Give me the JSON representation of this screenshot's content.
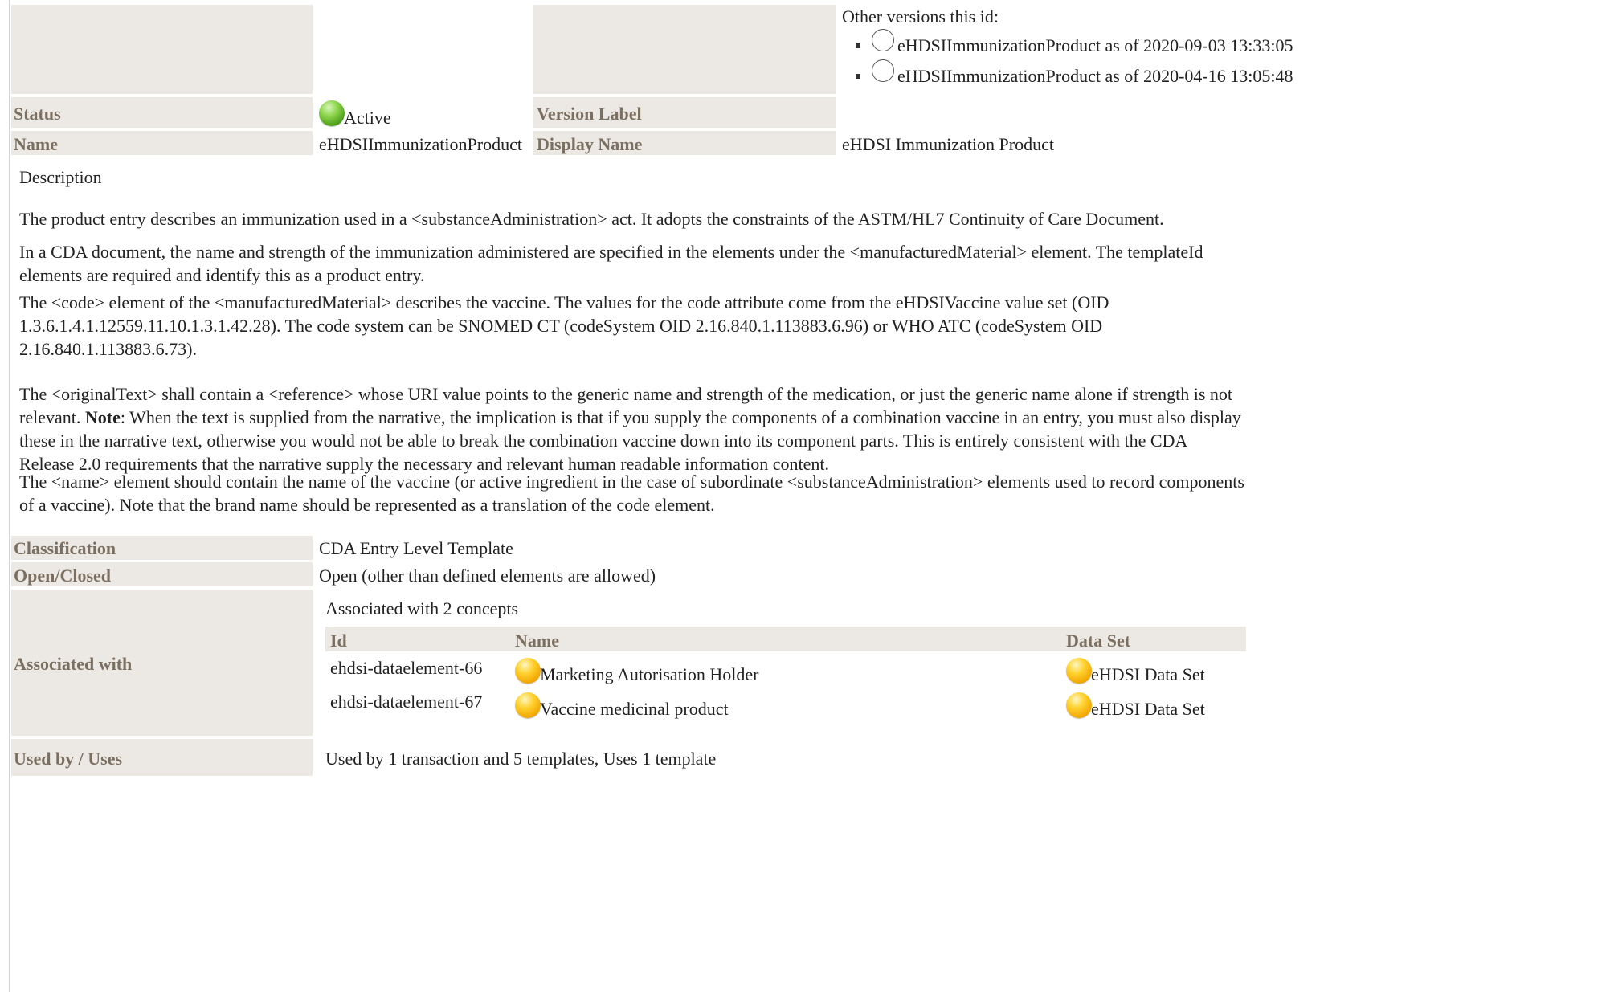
{
  "colors": {
    "label_background": "#ece9e4",
    "label_text": "#7a6f61",
    "status_active": "#4a9d16",
    "concept_ball": "#f2a500"
  },
  "other_versions": {
    "heading": "Other versions this id:",
    "items": [
      {
        "label": "eHDSIImmunizationProduct as of 2020-09-03 13:33:05",
        "icon": "radio-circle-icon"
      },
      {
        "label": "eHDSIImmunizationProduct as of 2020-04-16 13:05:48",
        "icon": "radio-circle-icon"
      }
    ]
  },
  "status": {
    "label": "Status",
    "value": "Active",
    "icon": "green-status-ball-icon"
  },
  "version_label": {
    "label": "Version Label",
    "value": ""
  },
  "name": {
    "label": "Name",
    "value": "eHDSIImmunizationProduct"
  },
  "display_name": {
    "label": "Display Name",
    "value": "eHDSI Immunization Product"
  },
  "description": {
    "heading": "Description",
    "p1": "The product entry describes an immunization used in a <substanceAdministration> act. It adopts the constraints of the ASTM/HL7 Continuity of Care Document.",
    "p2": "In a CDA document, the name and strength of the immunization administered are specified in the elements under the <manufacturedMaterial> element. The templateId elements are required and identify this as a product entry.",
    "p3": "The <code> element of the <manufacturedMaterial> describes the vaccine. The values for the code attribute come from the eHDSIVaccine value set (OID 1.3.6.1.4.1.12559.11.10.1.3.1.42.28). The code system can be SNOMED CT (codeSystem OID 2.16.840.1.113883.6.96) or WHO ATC (codeSystem OID 2.16.840.1.113883.6.73).",
    "p4_before": "The <originalText> shall contain a <reference> whose URI value points to the generic name and strength of the medication, or just the generic name alone if strength is not relevant. ",
    "p4_bold": "Note",
    "p4_after": ": When the text is supplied from the narrative, the implication is that if you supply the components of a combination vaccine in an entry, you must also display these in the narrative text, otherwise you would not be able to break the combination vaccine down into its component parts. This is entirely consistent with the CDA Release 2.0 requirements that the narrative supply the necessary and relevant human readable information content.",
    "p5": "The <name> element should contain the name of the vaccine (or active ingredient in the case of subordinate <substanceAdministration> elements used to record components of a vaccine). Note that the brand name should be represented as a translation of the code element."
  },
  "classification": {
    "label": "Classification",
    "value": "CDA Entry Level Template"
  },
  "open_closed": {
    "label": "Open/Closed",
    "value": "Open (other than defined elements are allowed)"
  },
  "associated_with": {
    "label": "Associated with",
    "summary": "Associated with 2 concepts",
    "columns": [
      "Id",
      "Name",
      "Data Set"
    ],
    "rows": [
      {
        "id": "ehdsi-dataelement-66",
        "name": "Marketing Autorisation Holder",
        "dataset": "eHDSI Data Set"
      },
      {
        "id": "ehdsi-dataelement-67",
        "name": "Vaccine medicinal product",
        "dataset": "eHDSI Data Set"
      }
    ]
  },
  "used_by": {
    "label": "Used by / Uses",
    "value": "Used by 1 transaction and 5 templates, Uses 1 template"
  }
}
